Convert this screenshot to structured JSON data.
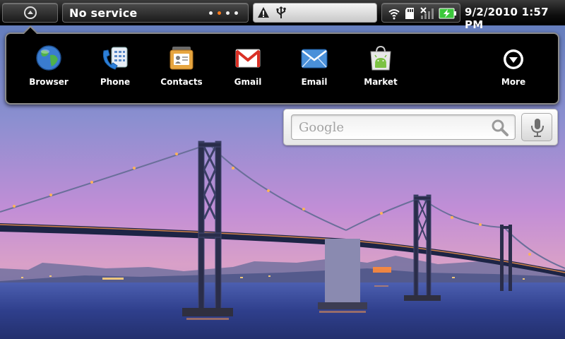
{
  "status_bar": {
    "home_button_icon": "home-up-arrow-icon",
    "carrier_text": "No service",
    "page_dots": 4,
    "active_dot_index": 1,
    "notification_icons": [
      "warning-icon",
      "usb-icon"
    ],
    "system_icons": [
      "wifi-icon",
      "sd-card-icon",
      "no-signal-icon",
      "battery-charging-icon"
    ],
    "clock": "9/2/2010 1:57 PM"
  },
  "launcher": {
    "apps": [
      {
        "label": "Browser",
        "icon": "globe-icon"
      },
      {
        "label": "Phone",
        "icon": "phone-icon"
      },
      {
        "label": "Contacts",
        "icon": "contacts-icon"
      },
      {
        "label": "Gmail",
        "icon": "gmail-icon"
      },
      {
        "label": "Email",
        "icon": "email-icon"
      },
      {
        "label": "Market",
        "icon": "market-icon"
      }
    ],
    "more": {
      "label": "More",
      "icon": "more-chevron-icon"
    }
  },
  "search_widget": {
    "placeholder": "Google",
    "search_icon": "magnifier-icon",
    "voice_icon": "microphone-icon"
  },
  "wallpaper": {
    "subject": "bridge-at-dusk"
  },
  "colors": {
    "accent_dot": "#ff7a1a",
    "battery_green": "#3cc83c",
    "gmail_red": "#d93025"
  }
}
